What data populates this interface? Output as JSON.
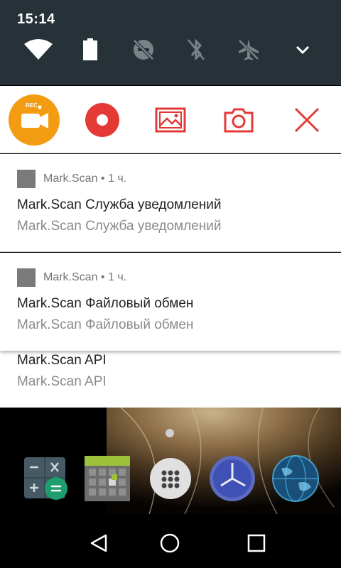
{
  "status": {
    "time": "15:14"
  },
  "quick_settings": {
    "tiles": [
      {
        "icon": "wifi-icon",
        "state": "on"
      },
      {
        "icon": "battery-icon",
        "state": "full"
      },
      {
        "icon": "do-not-disturb-off-icon",
        "state": "off"
      },
      {
        "icon": "bluetooth-off-icon",
        "state": "off"
      },
      {
        "icon": "airplane-mode-off-icon",
        "state": "off"
      }
    ],
    "expand_icon": "chevron-down-icon"
  },
  "recorder": {
    "rec_badge": "REC",
    "accent": "#f39c12",
    "red": "#e53935",
    "buttons": [
      "rec-app-icon",
      "record-icon",
      "gallery-icon",
      "camera-icon",
      "close-icon"
    ]
  },
  "notifications": [
    {
      "app": "Mark.Scan",
      "time": "1 ч.",
      "title": "Mark.Scan Служба уведомлений",
      "text": "Mark.Scan Служба уведомлений"
    },
    {
      "app": "Mark.Scan",
      "time": "1 ч.",
      "title": "Mark.Scan Файловый обмен",
      "text": "Mark.Scan Файловый обмен"
    },
    {
      "title": "Mark.Scan API",
      "text": "Mark.Scan API"
    }
  ],
  "dock": [
    "calculator-icon",
    "game-icon",
    "app-drawer-icon",
    "clock-icon",
    "browser-globe-icon"
  ],
  "nav": [
    "back-icon",
    "home-icon",
    "recents-icon"
  ]
}
